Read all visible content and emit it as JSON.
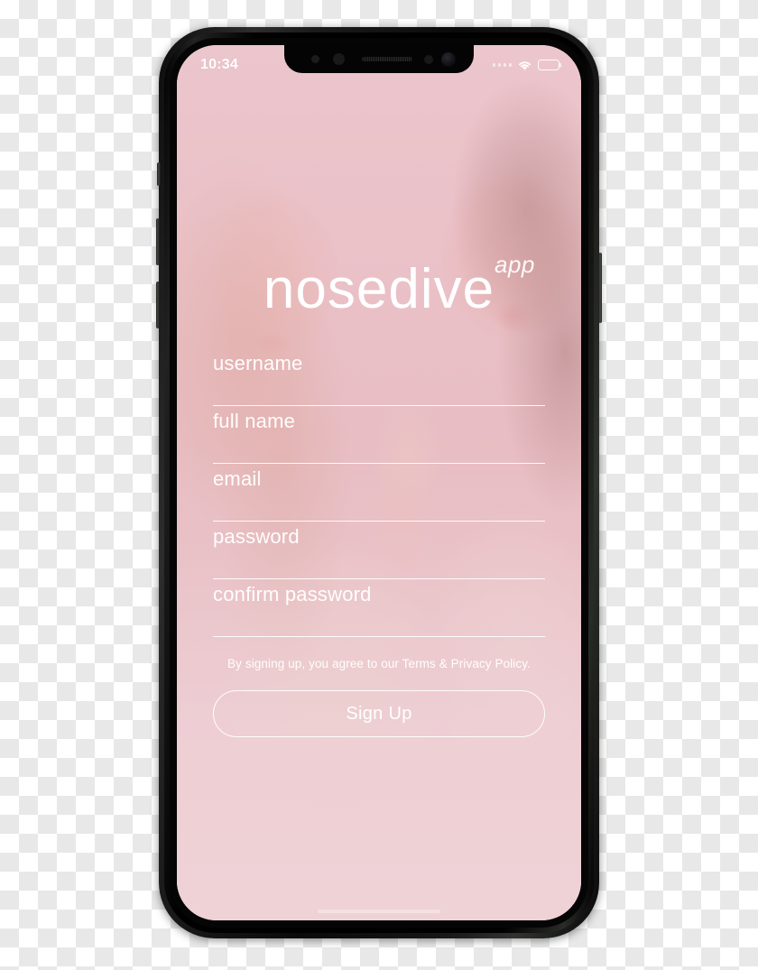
{
  "status_bar": {
    "time": "10:34",
    "signal_icon": "signal-dots-icon",
    "wifi_icon": "wifi-icon",
    "battery_icon": "battery-full-icon",
    "signal_dots": 4
  },
  "app": {
    "logo_word": "nosedive",
    "logo_suffix": "app"
  },
  "form": {
    "fields": [
      {
        "name": "username",
        "placeholder": "username",
        "value": ""
      },
      {
        "name": "full-name",
        "placeholder": "full name",
        "value": ""
      },
      {
        "name": "email",
        "placeholder": "email",
        "value": ""
      },
      {
        "name": "password",
        "placeholder": "password",
        "value": ""
      },
      {
        "name": "confirm-password",
        "placeholder": "confirm password",
        "value": ""
      }
    ],
    "terms_text": "By signing up, you agree to our Terms & Privacy Policy.",
    "submit_label": "Sign Up"
  },
  "colors": {
    "screen_pink": "#ecccd2",
    "text_white": "#ffffff",
    "device_black": "#050505",
    "tint_overlay": "#ebc0c8"
  }
}
